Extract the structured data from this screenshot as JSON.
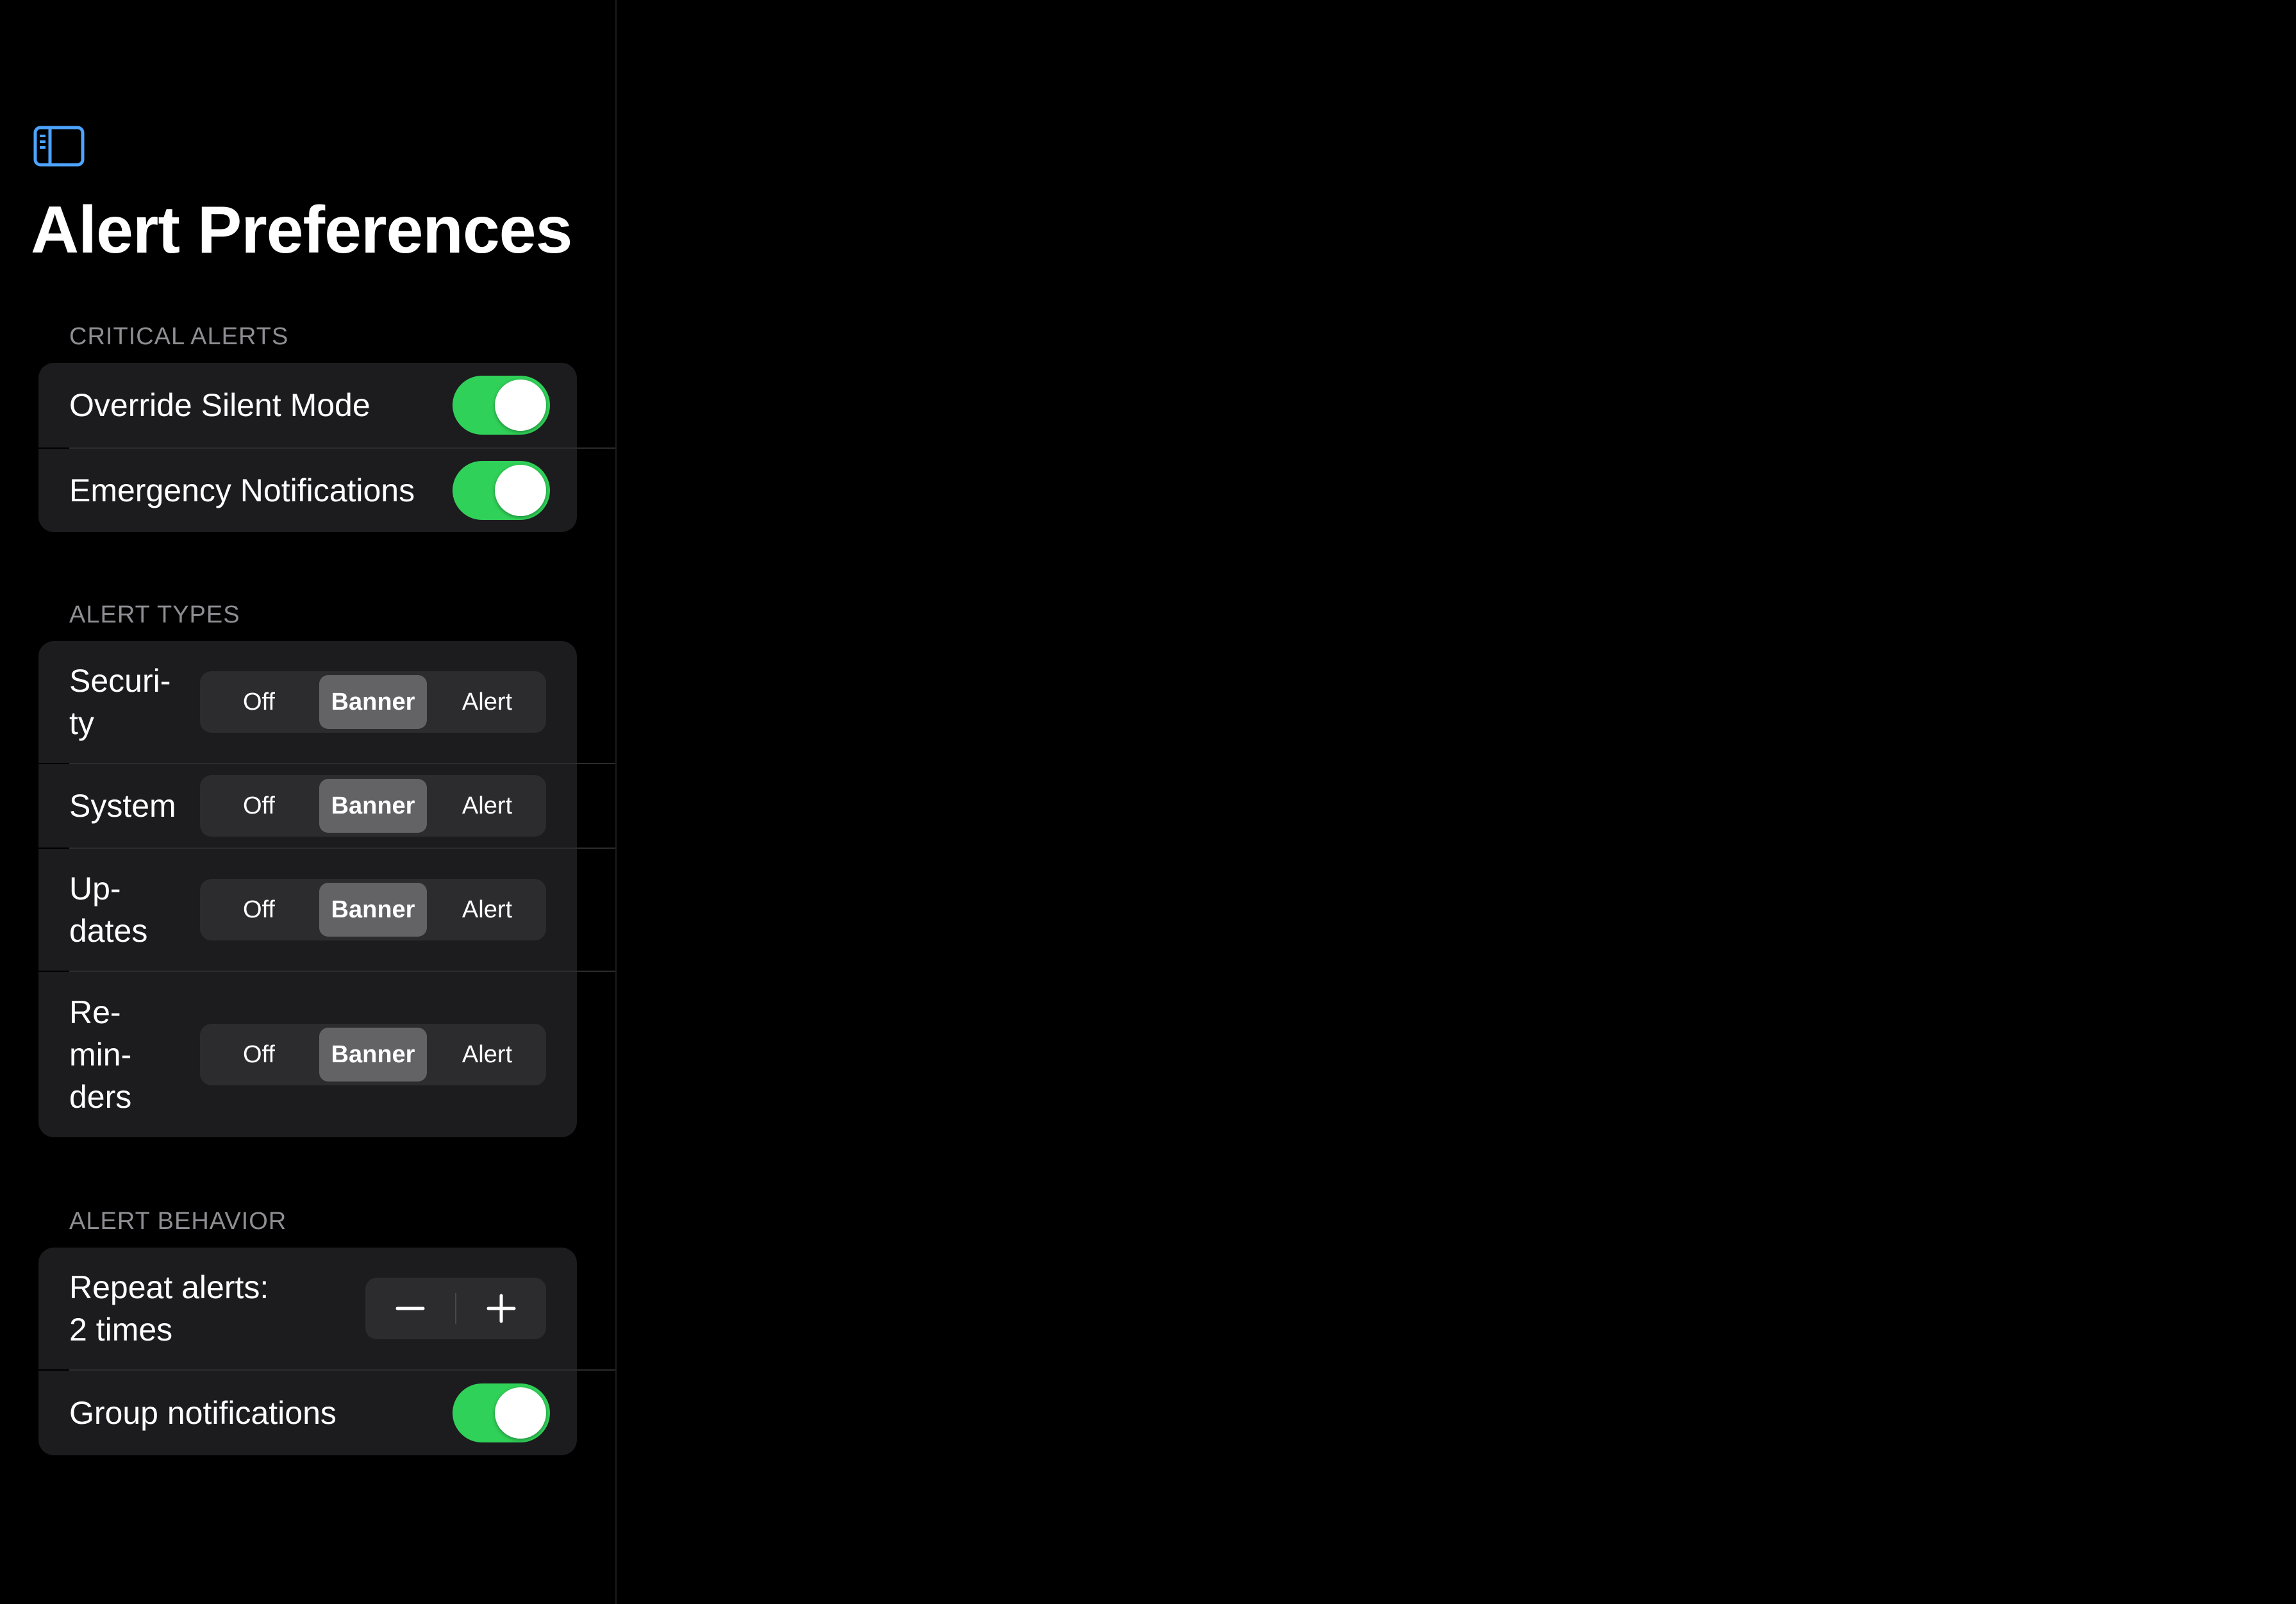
{
  "page": {
    "title": "Alert Preferences"
  },
  "sidebar_toggle": {
    "icon": "sidebar-left-icon",
    "color": "#0a84ff"
  },
  "sections": {
    "critical": {
      "header": "CRITICAL ALERTS",
      "rows": [
        {
          "label": "Override Silent Mode",
          "on": true
        },
        {
          "label": "Emergency Notifications",
          "on": true
        }
      ]
    },
    "types": {
      "header": "ALERT TYPES",
      "options": [
        "Off",
        "Banner",
        "Alert"
      ],
      "rows": [
        {
          "label": "Securi-\nty",
          "selected": "Banner"
        },
        {
          "label": "System",
          "selected": "Banner"
        },
        {
          "label": "Up-\ndates",
          "selected": "Banner"
        },
        {
          "label": "Re-\nmin-\nders",
          "selected": "Banner"
        }
      ]
    },
    "behavior": {
      "header": "ALERT BEHAVIOR",
      "repeat_label": "Repeat alerts:\n2 times",
      "stepper": {
        "minus_icon": "minus-icon",
        "plus_icon": "plus-icon"
      },
      "group": {
        "label": "Group notifications",
        "on": true
      }
    }
  },
  "colors": {
    "toggle_on": "#30d158",
    "card_bg": "#1c1c1e",
    "accent": "#0a84ff",
    "secondary_text": "#8e8e93",
    "segment_selected": "#636366"
  }
}
